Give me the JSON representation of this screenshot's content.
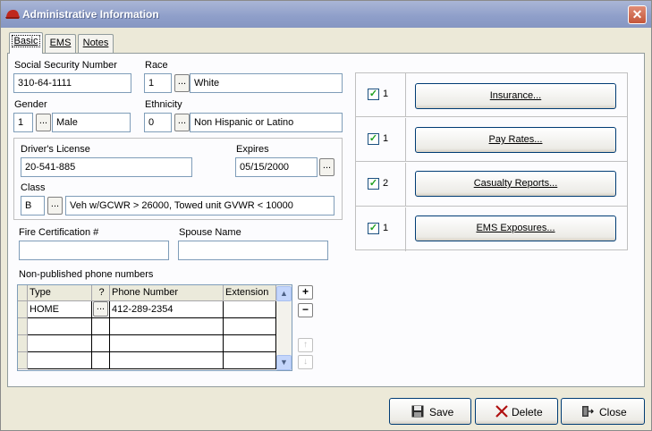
{
  "window": {
    "title": "Administrative Information",
    "close_symbol": "✕"
  },
  "tabs": [
    {
      "label": "Basic",
      "active": true
    },
    {
      "label": "EMS",
      "active": false
    },
    {
      "label": "Notes",
      "active": false
    }
  ],
  "form": {
    "ssn": {
      "label": "Social Security Number",
      "value": "310-64-1111"
    },
    "race": {
      "label": "Race",
      "code": "1",
      "text": "White"
    },
    "gender": {
      "label": "Gender",
      "code": "1",
      "text": "Male"
    },
    "ethnicity": {
      "label": "Ethnicity",
      "code": "0",
      "text": "Non Hispanic or Latino"
    },
    "drivers_license": {
      "label": "Driver's License",
      "value": "20-541-885"
    },
    "expires": {
      "label": "Expires",
      "value": "05/15/2000"
    },
    "class": {
      "label": "Class",
      "code": "B",
      "text": "Veh w/GCWR > 26000, Towed unit GVWR < 10000"
    },
    "fire_cert": {
      "label": "Fire Certification #",
      "value": ""
    },
    "spouse": {
      "label": "Spouse Name",
      "value": ""
    },
    "ellipsis": "..."
  },
  "phones": {
    "label": "Non-published phone numbers",
    "columns": [
      "Type",
      "?",
      "Phone Number",
      "Extension"
    ],
    "rows": [
      {
        "type": "HOME",
        "q": "...",
        "number": "412-289-2354",
        "ext": ""
      }
    ],
    "add_symbol": "+",
    "remove_symbol": "−",
    "up_symbol": "↑",
    "down_symbol": "↓"
  },
  "right_panel": [
    {
      "count": "1",
      "button": "Insurance...",
      "checked": true
    },
    {
      "count": "1",
      "button": "Pay Rates...",
      "checked": true
    },
    {
      "count": "2",
      "button": "Casualty Reports...",
      "checked": true
    },
    {
      "count": "1",
      "button": "EMS Exposures...",
      "checked": true
    }
  ],
  "footer": {
    "save": "Save",
    "delete": "Delete",
    "close": "Close"
  },
  "colors": {
    "title_bar": "#8e9ec9",
    "close_button": "#c45639",
    "button_border": "#003c74"
  }
}
